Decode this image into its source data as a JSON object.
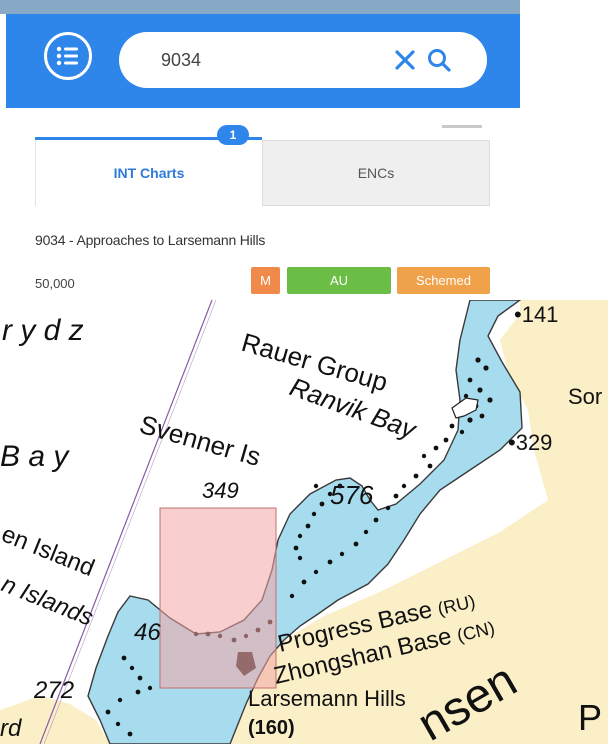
{
  "search": {
    "query": "9034"
  },
  "tabs": [
    {
      "label": "INT Charts",
      "badge": "1",
      "active": true
    },
    {
      "label": "ENCs",
      "active": false
    }
  ],
  "result": {
    "number": "9034",
    "separator": " - ",
    "title": "Approaches to Larsemann Hills",
    "scale": "50,000",
    "badges": [
      {
        "label": "M",
        "color": "#f08a4b"
      },
      {
        "label": "AU",
        "color": "#6cbd45"
      },
      {
        "label": "Schemed",
        "color": "#f0a24b"
      }
    ]
  },
  "map": {
    "colors": {
      "sea": "#a7dcef",
      "land": "#fbefc8",
      "highlight": "#f4a6a6"
    },
    "labels": {
      "prydz1": "r y d z",
      "prydz2": "B a y",
      "rauer": "Rauer Group",
      "ranvik": "Ranvik Bay",
      "svenner": "Svenner Is",
      "d349": "349",
      "d576": "576",
      "h141": "•141",
      "h329": "•329",
      "sor": "Sor",
      "island1": "en Island",
      "islands2": "n Islands",
      "d46": "46",
      "d272": "272",
      "rd": "rd",
      "progress": "Progress Base",
      "ru": "(RU)",
      "zhongshan": "Zhongshan Base",
      "cn": "(CN)",
      "larsemann": "Larsemann Hills",
      "h160": "(160)",
      "nsen": "nsen",
      "p": "P"
    }
  }
}
